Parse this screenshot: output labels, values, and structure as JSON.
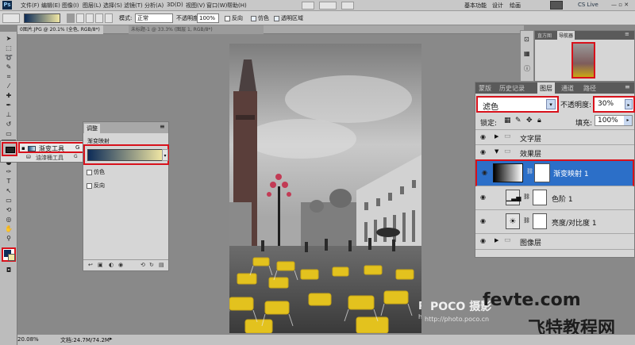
{
  "app": {
    "logo": "Ps"
  },
  "menu": [
    "文件(F)",
    "编辑(E)",
    "图像(I)",
    "图层(L)",
    "选择(S)",
    "滤镜(T)",
    "分析(A)",
    "3D(D)",
    "视图(V)",
    "窗口(W)",
    "帮助(H)"
  ],
  "workspace": {
    "basic": "基本功能",
    "design": "设计",
    "paint": "绘画",
    "cslive": "CS Live"
  },
  "options": {
    "mode_label": "模式:",
    "mode_value": "正常",
    "opacity_label": "不透明度:",
    "opacity_value": "100%",
    "reverse_label": "反向",
    "dither_label": "仿色",
    "transparency_label": "透明区域"
  },
  "document": {
    "tab_active": "0图片.JPG @ 20.1% (全色, RGB/8*)",
    "tab_inactive": "未标题-1 @ 33.3% (图层 1, RGB/8*)",
    "zoom": "20.08%",
    "doc_size": "文档:24.7M/74.2M"
  },
  "tool_flyout": {
    "items": [
      {
        "label": "渐变工具",
        "key": "G"
      },
      {
        "label": "油漆桶工具",
        "key": "G"
      }
    ]
  },
  "adjustments_panel": {
    "tab": "调整",
    "heading": "渐变映射",
    "dither": "仿色",
    "reverse": "反向"
  },
  "navigator": {
    "tabs": [
      "直方图",
      "导航器"
    ]
  },
  "layers_panel": {
    "tabs": [
      "蒙版",
      "历史记录",
      "图层",
      "通道",
      "路径"
    ],
    "blend_mode": "滤色",
    "opacity_label": "不透明度:",
    "opacity_value": "30%",
    "lock_label": "锁定:",
    "fill_label": "填充:",
    "fill_value": "100%",
    "layers": [
      {
        "name": "文字层",
        "type": "group"
      },
      {
        "name": "效果层",
        "type": "group-open"
      },
      {
        "name": "渐变映射 1",
        "type": "adjustment",
        "selected": true
      },
      {
        "name": "色阶 1",
        "type": "adjustment"
      },
      {
        "name": "亮度/对比度 1",
        "type": "adjustment"
      },
      {
        "name": "图像层",
        "type": "group"
      }
    ]
  },
  "watermarks": {
    "poco": "POCO 摄影",
    "poco_url": "http://photo.poco.cn",
    "fevte": "fevte.com",
    "fevte_cn": "飞特教程网"
  },
  "colors": {
    "accent_selected": "#2c6fc8",
    "highlight_red": "#d8111b",
    "gradient_from": "#0d2c58",
    "gradient_to": "#f1e7a4"
  }
}
